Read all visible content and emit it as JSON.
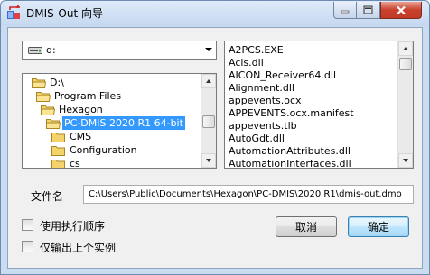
{
  "window": {
    "title": "DMIS-Out 向导",
    "icon": "dmis-app-icon"
  },
  "drive": {
    "value": "d:",
    "icon": "drive-icon"
  },
  "tree": {
    "items": [
      {
        "label": "D:\\",
        "indent": 0,
        "selected": false
      },
      {
        "label": "Program Files",
        "indent": 1,
        "selected": false
      },
      {
        "label": "Hexagon",
        "indent": 2,
        "selected": false
      },
      {
        "label": "PC-DMIS 2020 R1 64-bit",
        "indent": 3,
        "selected": true
      },
      {
        "label": "CMS",
        "indent": 4,
        "selected": false
      },
      {
        "label": "Configuration",
        "indent": 4,
        "selected": false
      },
      {
        "label": "cs",
        "indent": 4,
        "selected": false
      }
    ]
  },
  "files": {
    "items": [
      "A2PCS.EXE",
      "Acis.dll",
      "AICON_Receiver64.dll",
      "Alignment.dll",
      "appevents.ocx",
      "APPEVENTS.ocx.manifest",
      "appevents.tlb",
      "AutoGdt.dll",
      "AutomationAttributes.dll",
      "AutomationInterfaces.dll"
    ]
  },
  "filename": {
    "label": "文件名",
    "value": "C:\\Users\\Public\\Documents\\Hexagon\\PC-DMIS\\2020 R1\\dmis-out.dmo"
  },
  "options": {
    "use_exec_order": "使用执行顺序",
    "output_last_instance": "仅输出上个实例"
  },
  "buttons": {
    "cancel": "取消",
    "ok": "确定"
  },
  "colors": {
    "selection": "#3399ff",
    "titlebar": "#c5d8ef",
    "close_button": "#c9412d"
  }
}
